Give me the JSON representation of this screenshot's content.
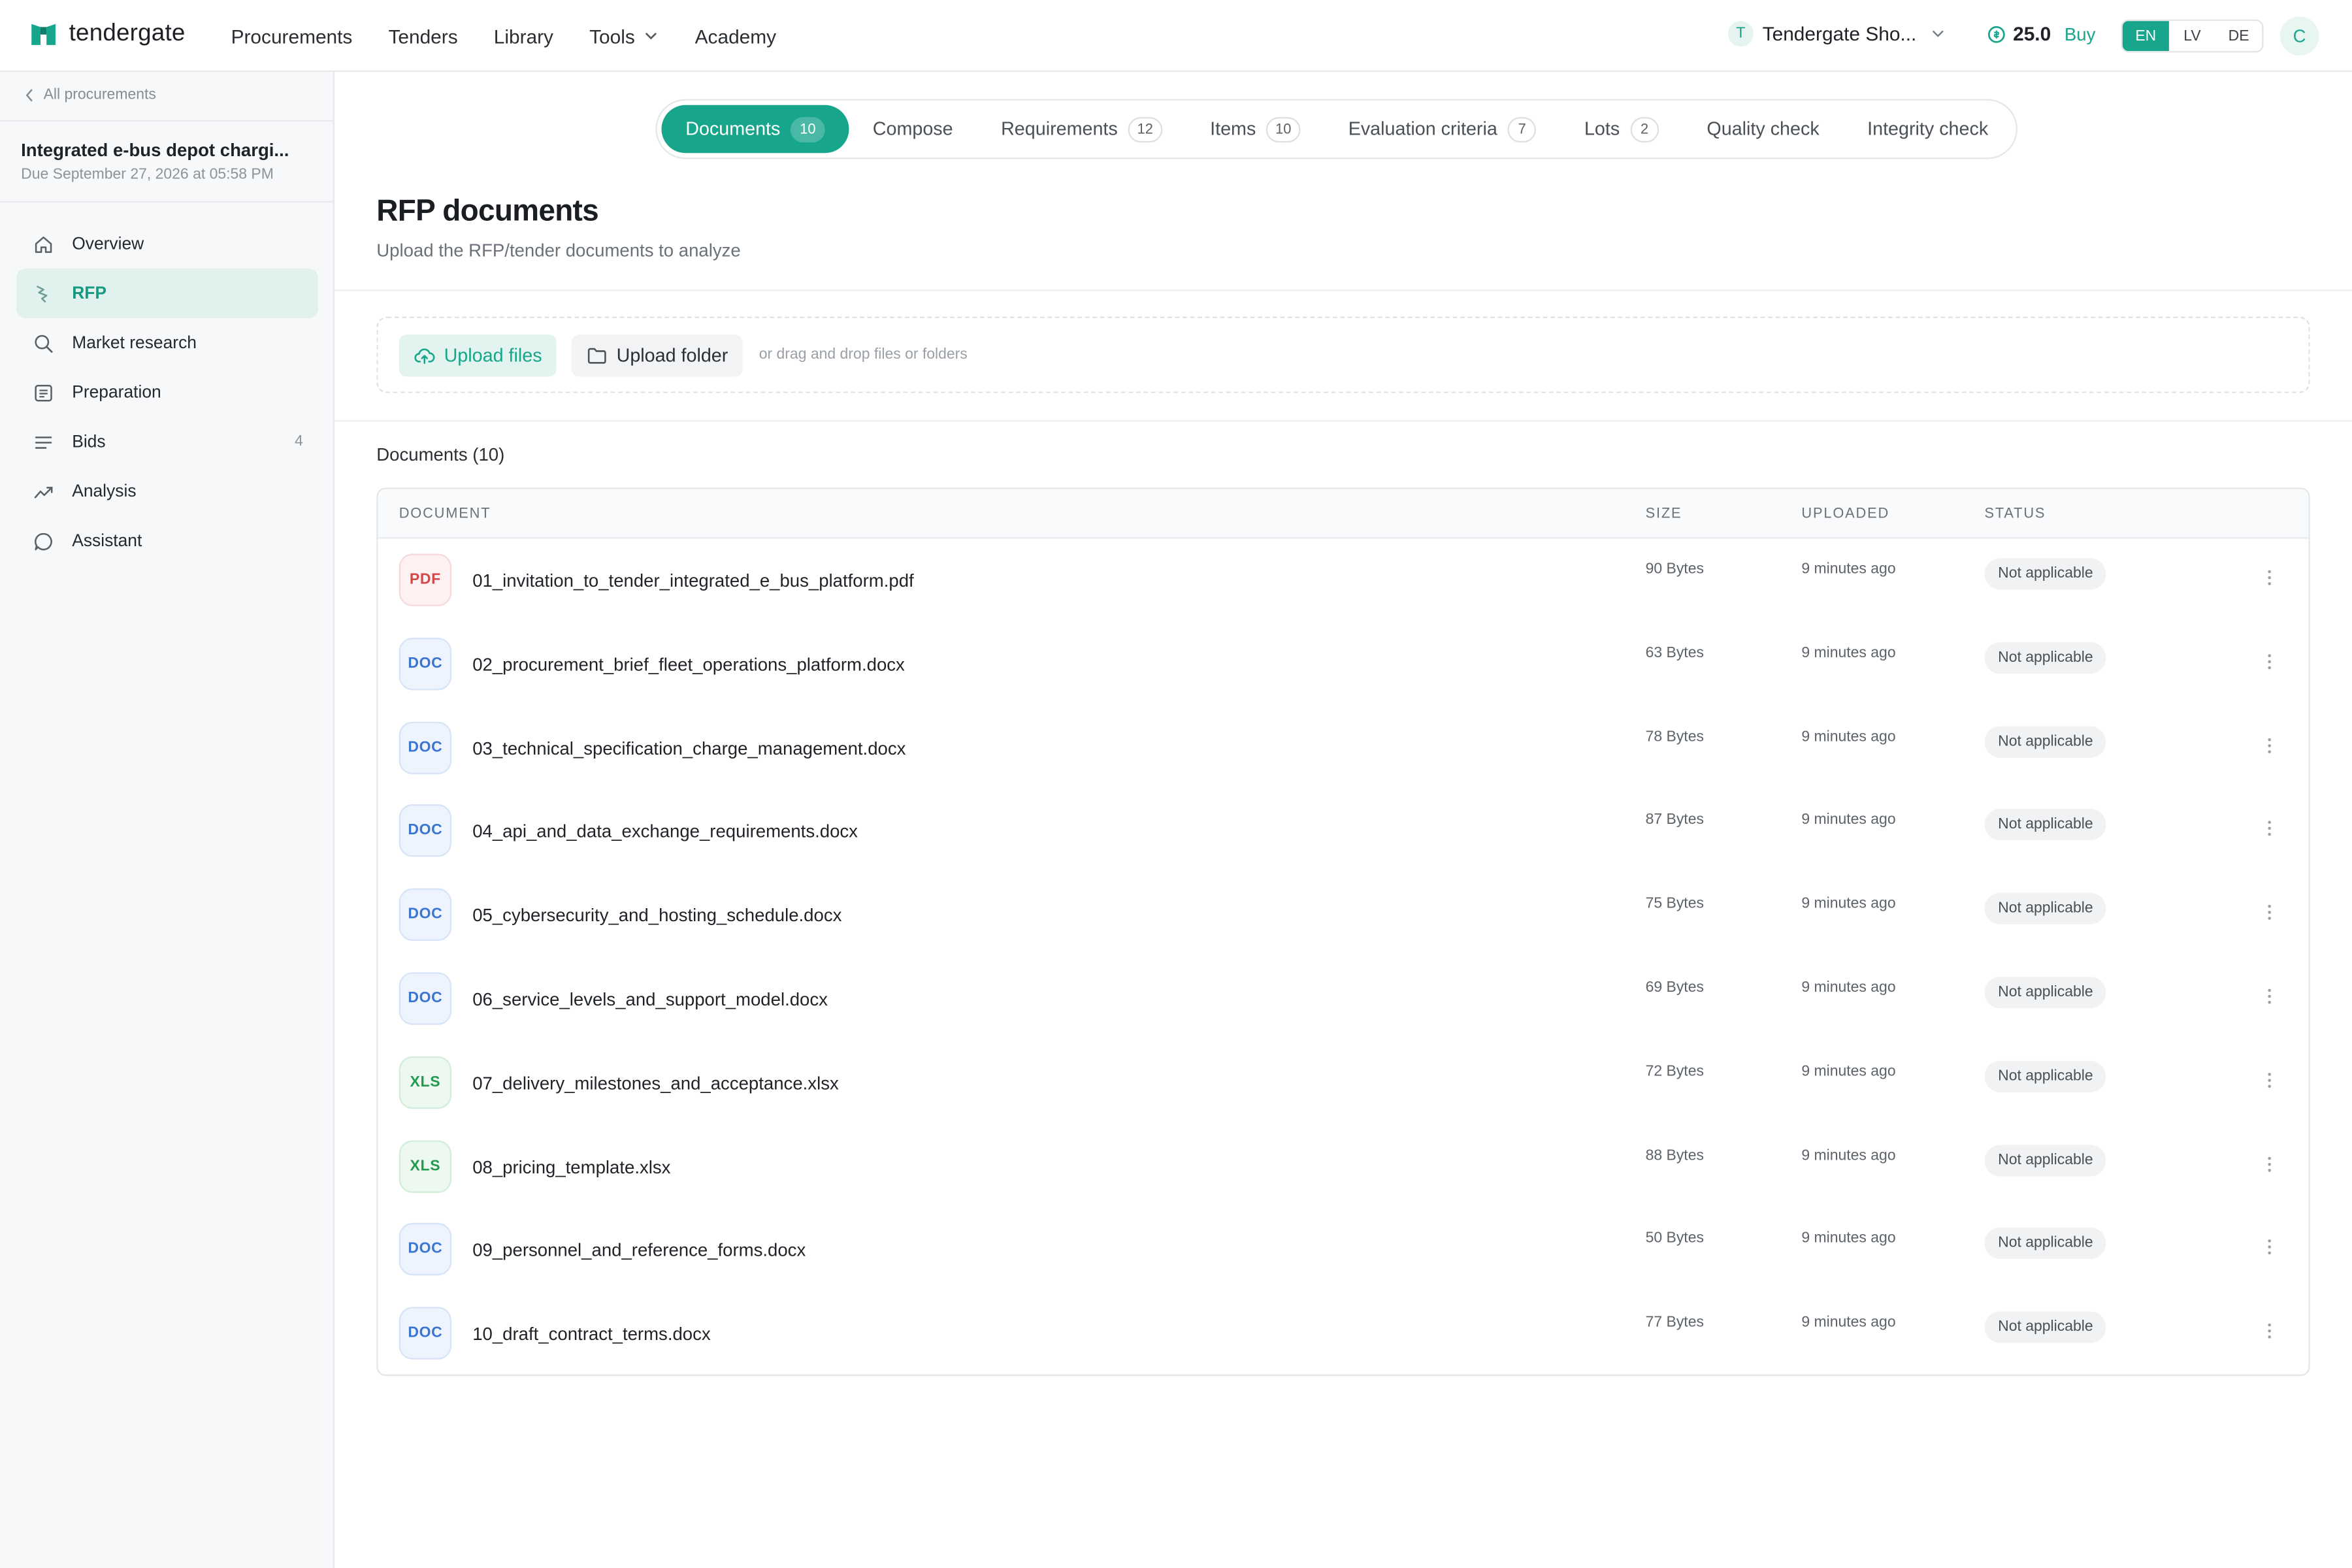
{
  "brand": {
    "name": "tendergate",
    "accent": "#17a58b"
  },
  "topnav": [
    {
      "label": "Procurements"
    },
    {
      "label": "Tenders"
    },
    {
      "label": "Library"
    },
    {
      "label": "Tools",
      "dropdown": true
    },
    {
      "label": "Academy"
    }
  ],
  "account": {
    "org_initial": "T",
    "org_name": "Tendergate Sho...",
    "credits": "25.0",
    "buy_label": "Buy",
    "languages": [
      "EN",
      "LV",
      "DE"
    ],
    "active_language": "EN",
    "user_initial": "C"
  },
  "sidebar": {
    "back_label": "All procurements",
    "procurement_title": "Integrated e-bus depot chargi...",
    "procurement_due": "Due September 27, 2026 at 05:58 PM",
    "items": [
      {
        "label": "Overview",
        "icon": "home-icon"
      },
      {
        "label": "RFP",
        "icon": "rfp-icon",
        "active": true
      },
      {
        "label": "Market research",
        "icon": "search-icon"
      },
      {
        "label": "Preparation",
        "icon": "preparation-icon"
      },
      {
        "label": "Bids",
        "icon": "list-icon",
        "count": "4"
      },
      {
        "label": "Analysis",
        "icon": "trend-icon"
      },
      {
        "label": "Assistant",
        "icon": "chat-icon"
      }
    ]
  },
  "tabs": [
    {
      "label": "Documents",
      "count": "10",
      "active": true
    },
    {
      "label": "Compose",
      "count": ""
    },
    {
      "label": "Requirements",
      "count": "12"
    },
    {
      "label": "Items",
      "count": "10"
    },
    {
      "label": "Evaluation criteria",
      "count": "7"
    },
    {
      "label": "Lots",
      "count": "2"
    },
    {
      "label": "Quality check",
      "count": ""
    },
    {
      "label": "Integrity check",
      "count": ""
    }
  ],
  "page": {
    "title": "RFP documents",
    "subtitle": "Upload the RFP/tender documents to analyze"
  },
  "upload": {
    "files_label": "Upload files",
    "folder_label": "Upload folder",
    "hint": "or drag and drop files or folders"
  },
  "documents": {
    "heading": "Documents (10)",
    "columns": {
      "document": "DOCUMENT",
      "size": "SIZE",
      "uploaded": "UPLOADED",
      "status": "STATUS"
    },
    "rows": [
      {
        "type": "PDF",
        "name": "01_invitation_to_tender_integrated_e_bus_platform.pdf",
        "size": "90 Bytes",
        "uploaded": "9 minutes ago",
        "status": "Not applicable"
      },
      {
        "type": "DOC",
        "name": "02_procurement_brief_fleet_operations_platform.docx",
        "size": "63 Bytes",
        "uploaded": "9 minutes ago",
        "status": "Not applicable"
      },
      {
        "type": "DOC",
        "name": "03_technical_specification_charge_management.docx",
        "size": "78 Bytes",
        "uploaded": "9 minutes ago",
        "status": "Not applicable"
      },
      {
        "type": "DOC",
        "name": "04_api_and_data_exchange_requirements.docx",
        "size": "87 Bytes",
        "uploaded": "9 minutes ago",
        "status": "Not applicable"
      },
      {
        "type": "DOC",
        "name": "05_cybersecurity_and_hosting_schedule.docx",
        "size": "75 Bytes",
        "uploaded": "9 minutes ago",
        "status": "Not applicable"
      },
      {
        "type": "DOC",
        "name": "06_service_levels_and_support_model.docx",
        "size": "69 Bytes",
        "uploaded": "9 minutes ago",
        "status": "Not applicable"
      },
      {
        "type": "XLS",
        "name": "07_delivery_milestones_and_acceptance.xlsx",
        "size": "72 Bytes",
        "uploaded": "9 minutes ago",
        "status": "Not applicable"
      },
      {
        "type": "XLS",
        "name": "08_pricing_template.xlsx",
        "size": "88 Bytes",
        "uploaded": "9 minutes ago",
        "status": "Not applicable"
      },
      {
        "type": "DOC",
        "name": "09_personnel_and_reference_forms.docx",
        "size": "50 Bytes",
        "uploaded": "9 minutes ago",
        "status": "Not applicable"
      },
      {
        "type": "DOC",
        "name": "10_draft_contract_terms.docx",
        "size": "77 Bytes",
        "uploaded": "9 minutes ago",
        "status": "Not applicable"
      }
    ]
  }
}
